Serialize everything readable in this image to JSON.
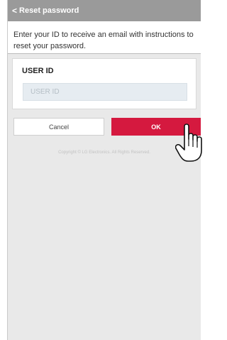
{
  "header": {
    "back_glyph": "<",
    "title": "Reset password"
  },
  "intro": {
    "line1": "Enter your ID to receive an email with instructions to",
    "line2": "reset your password."
  },
  "form": {
    "label": "USER ID",
    "placeholder": "USER ID",
    "value": ""
  },
  "actions": {
    "cancel_label": "Cancel",
    "ok_label": "OK"
  },
  "footer": {
    "copyright": "Copyright © LG Electronics. All Rights Reserved."
  },
  "colors": {
    "header_bg": "#9a9a9a",
    "accent": "#d5193f",
    "input_bg": "#e6ecf1",
    "page_bg": "#e9e9e9"
  },
  "icons": {
    "back": "chevron-left-icon",
    "pointer": "hand-pointer-icon"
  }
}
